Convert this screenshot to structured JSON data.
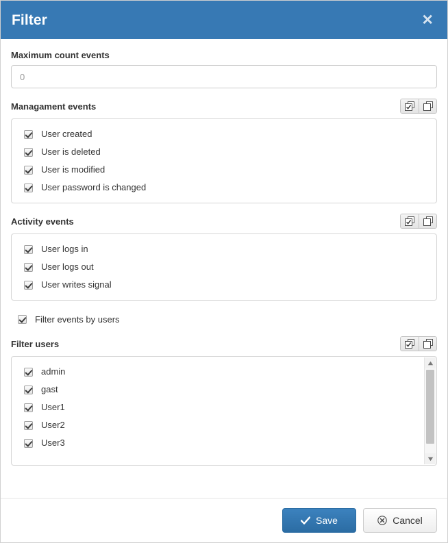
{
  "dialog": {
    "title": "Filter",
    "close_label": "✕"
  },
  "max_count": {
    "label": "Maximum count events",
    "value": "0"
  },
  "toolbar": {
    "select_all_icon": "check-all-icon",
    "deselect_all_icon": "uncheck-all-icon"
  },
  "sections": [
    {
      "title": "Managament events",
      "items": [
        {
          "label": "User created",
          "checked": true
        },
        {
          "label": "User is deleted",
          "checked": true
        },
        {
          "label": "User is modified",
          "checked": true
        },
        {
          "label": "User password is changed",
          "checked": true
        }
      ]
    },
    {
      "title": "Activity events",
      "items": [
        {
          "label": "User logs in",
          "checked": true
        },
        {
          "label": "User logs out",
          "checked": true
        },
        {
          "label": "User writes signal",
          "checked": true
        }
      ]
    }
  ],
  "filter_by_users": {
    "label": "Filter events by users",
    "checked": true
  },
  "filter_users": {
    "title": "Filter users",
    "items": [
      {
        "label": "admin",
        "checked": true
      },
      {
        "label": "gast",
        "checked": true
      },
      {
        "label": "User1",
        "checked": true
      },
      {
        "label": "User2",
        "checked": true
      },
      {
        "label": "User3",
        "checked": true
      }
    ]
  },
  "footer": {
    "save_label": "Save",
    "cancel_label": "Cancel"
  },
  "colors": {
    "header_blue": "#3779b4",
    "primary_button": "#2b6ca3",
    "border": "#d5d5d5"
  }
}
